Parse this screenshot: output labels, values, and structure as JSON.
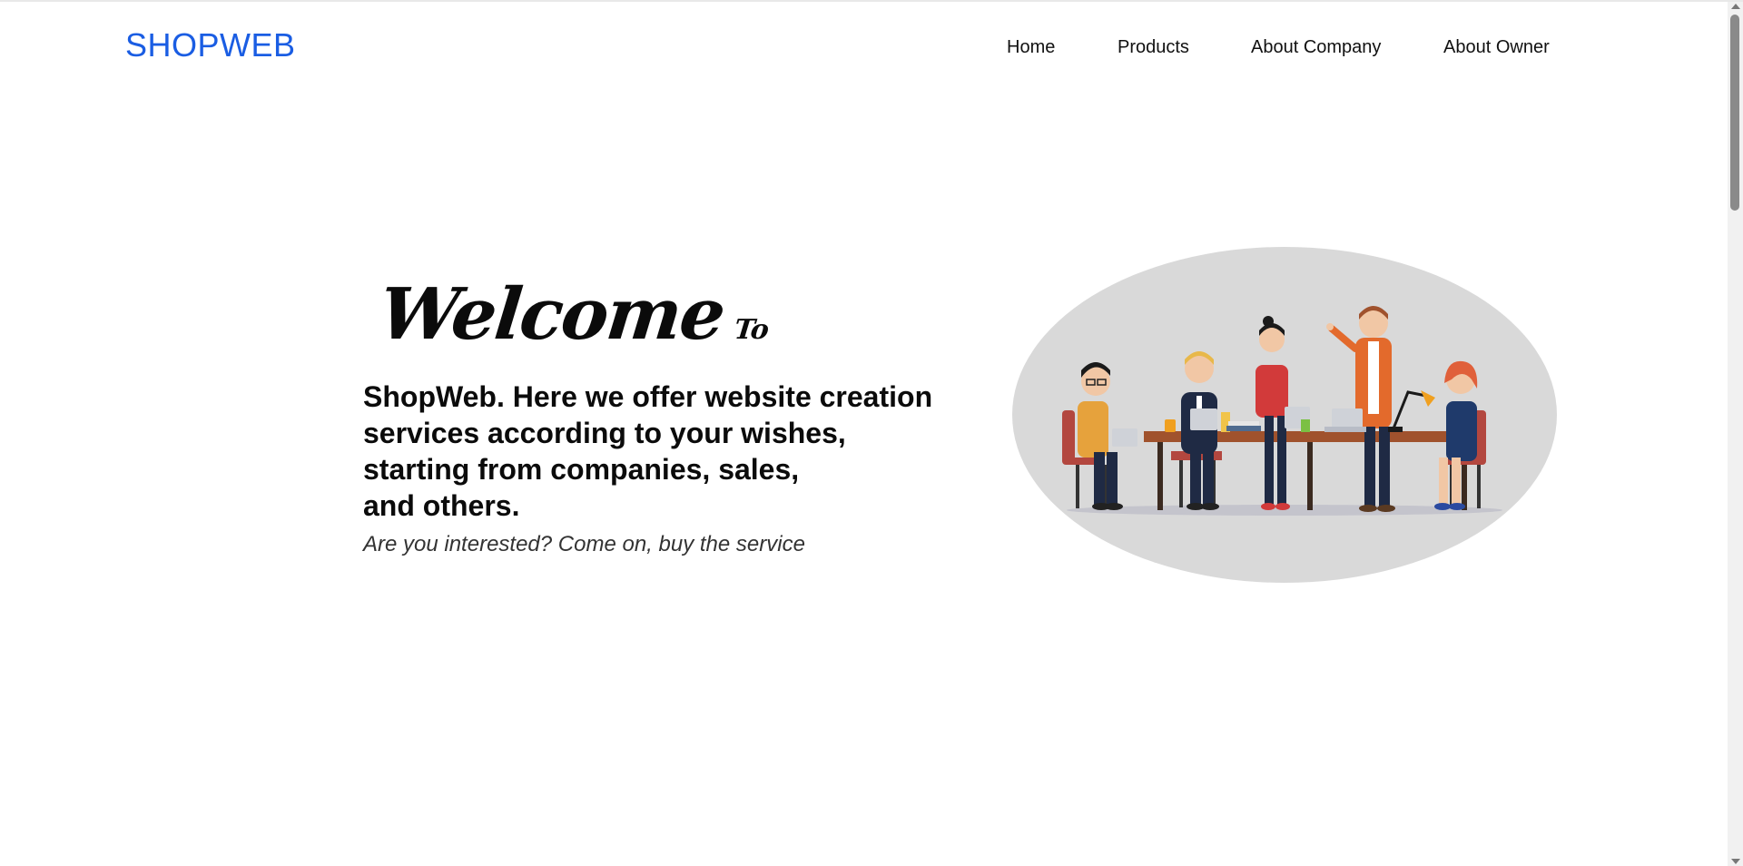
{
  "navbar": {
    "brand": "SHOPWEB",
    "links": {
      "home": "Home",
      "products": "Products",
      "about_company": "About Company",
      "about_owner": "About Owner"
    }
  },
  "hero": {
    "welcome": "Welcome",
    "to": "To",
    "headline": "ShopWeb. Here we offer website creation\nservices according to your wishes,\nstarting from companies, sales,\nand others.",
    "subline": "Are you interested? Come on, buy the service"
  },
  "colors": {
    "brand": "#1a5de3",
    "illustration_bg": "#d9d9d9"
  },
  "icons": {
    "illustration": "team-meeting-illustration"
  }
}
